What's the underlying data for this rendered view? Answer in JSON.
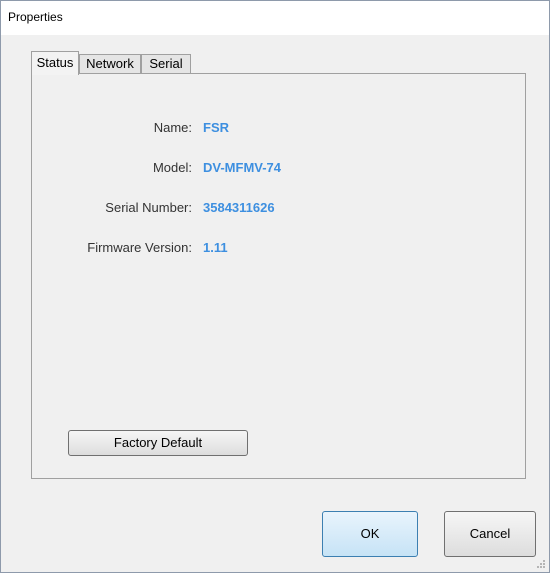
{
  "window": {
    "title": "Properties"
  },
  "tabs": [
    {
      "label": "Status",
      "active": true
    },
    {
      "label": "Network",
      "active": false
    },
    {
      "label": "Serial",
      "active": false
    }
  ],
  "status": {
    "fields": [
      {
        "label": "Name:",
        "value": "FSR"
      },
      {
        "label": "Model:",
        "value": "DV-MFMV-74"
      },
      {
        "label": "Serial Number:",
        "value": "3584311626"
      },
      {
        "label": "Firmware Version:",
        "value": "1.11"
      }
    ],
    "factory_default_label": "Factory Default"
  },
  "buttons": {
    "ok_label": "OK",
    "cancel_label": "Cancel"
  },
  "colors": {
    "value_text": "#3d8fe0",
    "window_bg": "#f0f0f0",
    "focus_border": "#3c7fb1"
  }
}
